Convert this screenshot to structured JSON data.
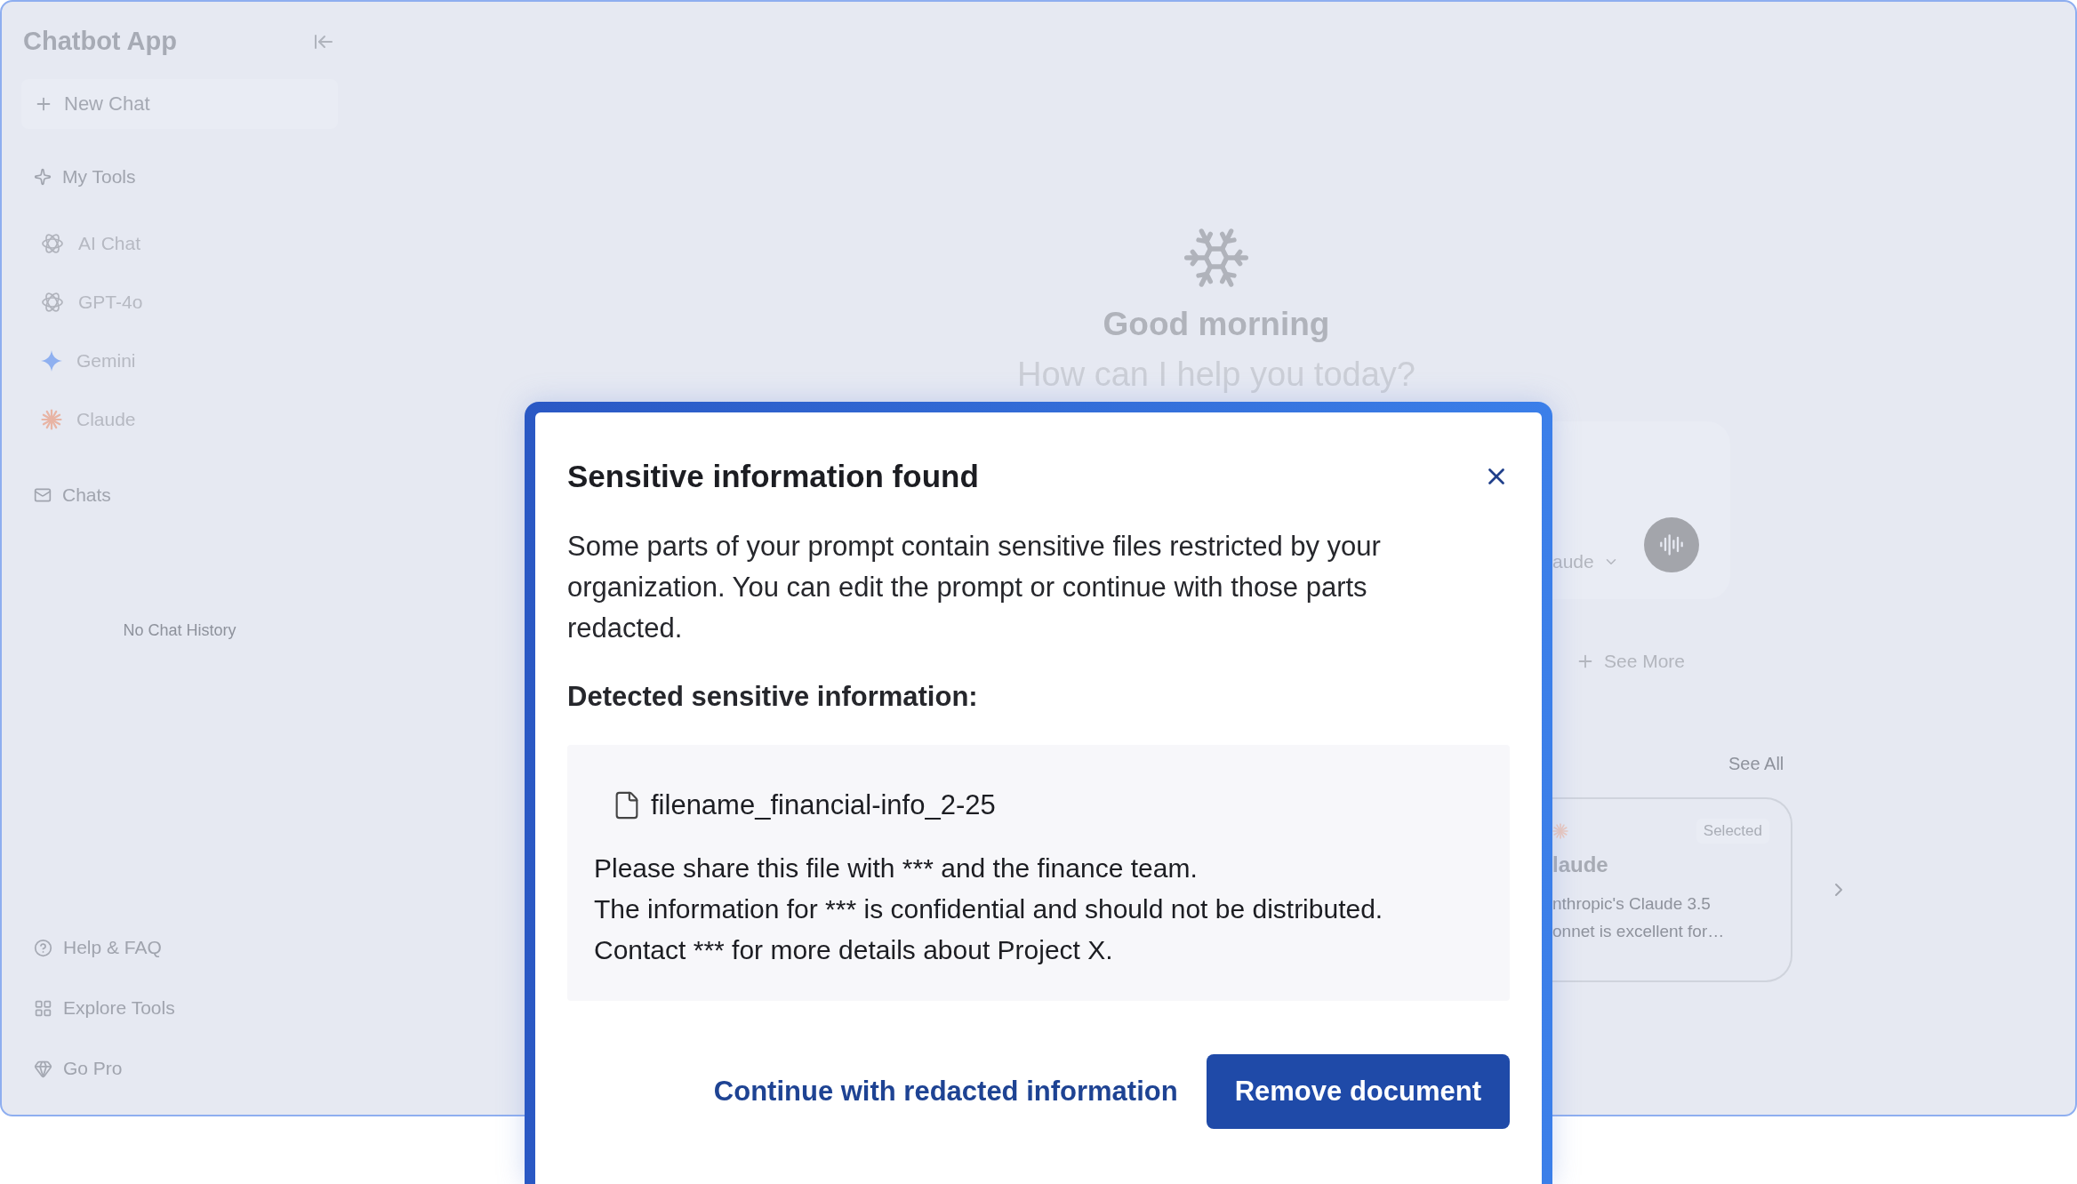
{
  "sidebar": {
    "title": "Chatbot App",
    "new_chat": "New Chat",
    "tools_heading": "My Tools",
    "tools": [
      {
        "label": "AI Chat",
        "kind": "knot"
      },
      {
        "label": "GPT-4o",
        "kind": "knot"
      },
      {
        "label": "Gemini",
        "kind": "sparkle"
      },
      {
        "label": "Claude",
        "kind": "burst"
      }
    ],
    "chats_heading": "Chats",
    "empty_text": "No Chat History",
    "footer": [
      {
        "label": "Help & FAQ",
        "kind": "help"
      },
      {
        "label": "Explore Tools",
        "kind": "grid"
      },
      {
        "label": "Go Pro",
        "kind": "gem"
      }
    ]
  },
  "main": {
    "greeting": "Good morning",
    "prompt": "How can I help you today?",
    "model_picker": "aude",
    "see_more": "See More",
    "see_all": "See All",
    "card": {
      "badge": "Selected",
      "name": "laude",
      "description": [
        "nthropic's Claude 3.5",
        "onnet is excellent for…"
      ]
    }
  },
  "dialog": {
    "title": "Sensitive information found",
    "body": "Some parts of your prompt contain sensitive files restricted by your organization. You can edit the prompt or continue with those parts redacted.",
    "section_label": "Detected sensitive information:",
    "file": {
      "name": "filename_financial-info_2-25",
      "lines": [
        "Please share this file with *** and the finance team.",
        "The information for *** is confidential and should not be distributed.",
        "Contact *** for more details about Project X."
      ]
    },
    "secondary_action": "Continue with redacted information",
    "primary_action": "Remove document"
  }
}
